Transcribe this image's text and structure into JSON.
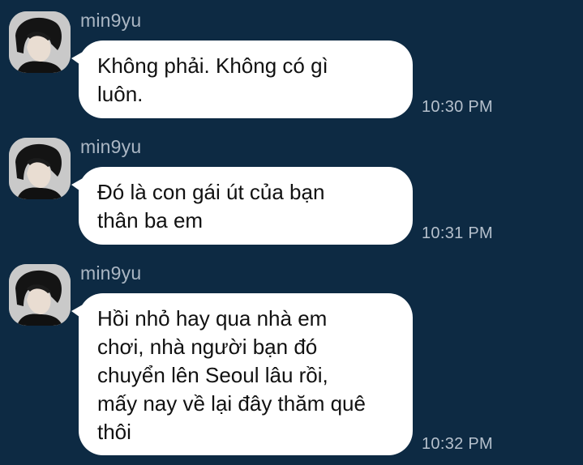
{
  "chat": {
    "background_color": "#0d2a43",
    "messages": [
      {
        "sender": "min9yu",
        "text": "Không phải. Không có gì\nluôn.",
        "time": "10:30 PM"
      },
      {
        "sender": "min9yu",
        "text": "Đó là con gái út của bạn\nthân ba em",
        "time": "10:31 PM"
      },
      {
        "sender": "min9yu",
        "text": "Hồi nhỏ hay qua nhà em\nchơi, nhà người bạn đó\nchuyển lên Seoul lâu rồi,\nmấy nay về lại đây thăm quê\nthôi",
        "time": "10:32 PM"
      }
    ]
  }
}
